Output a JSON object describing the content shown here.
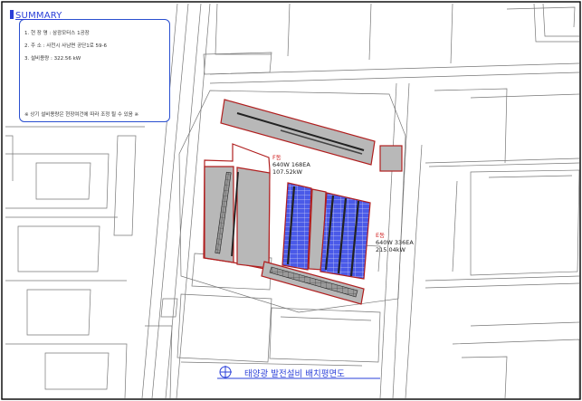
{
  "summary": {
    "heading": "SUMMARY",
    "line1": "1. 현 장 명 : 삼광모터스 1공장",
    "line2": "2. 주      소 : 사천시 사남면 공단1로 59-6",
    "line3": "3. 설비용량 : 322.56 kW",
    "note": "※ 상기 설비용량은 현장여건에 따라 조정 될 수 있음 ※"
  },
  "buildings": {
    "f": {
      "name": "F동",
      "spec": "640W 168EA",
      "capacity": "107.52kW"
    },
    "e": {
      "name": "E동",
      "spec": "640W 336EA",
      "capacity": "215.04kW"
    }
  },
  "drawing_title": "태양광 발전설비 배치평면도",
  "colors": {
    "outline": "#b01e1e",
    "roof": "#b8b8b8",
    "panel": "#4a5ae8",
    "accent_blue": "#2a3fd8",
    "ink": "#222222"
  }
}
